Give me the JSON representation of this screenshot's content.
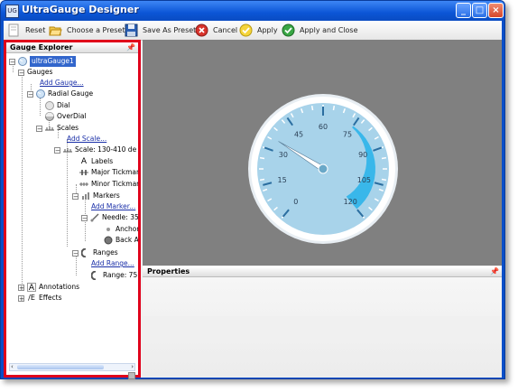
{
  "window": {
    "title": "UltraGauge Designer"
  },
  "title_buttons": {
    "minimize": "_",
    "maximize": "□",
    "close": "×"
  },
  "toolbar": {
    "reset": "Reset",
    "choose_preset": "Choose a Preset",
    "save_preset": "Save As Preset",
    "cancel": "Cancel",
    "apply": "Apply",
    "apply_close": "Apply and Close"
  },
  "explorer": {
    "title": "Gauge Explorer",
    "pin": "📌",
    "tree": {
      "root": "ultraGauge1",
      "gauges": "Gauges",
      "add_gauge": "Add Gauge...",
      "radial_gauge": "Radial Gauge",
      "dial": "Dial",
      "overdial": "OverDial",
      "scales": "Scales",
      "add_scale": "Add Scale...",
      "scale": "Scale: 130-410 de",
      "labels": "Labels",
      "major_tickmarks": "Major Tickmar",
      "minor_tickmarks": "Minor Tickmar",
      "markers": "Markers",
      "add_marker": "Add Marker...",
      "needle": "Needle: 35",
      "anchor": "Anchor",
      "back_anchor": "Back A",
      "ranges": "Ranges",
      "add_range": "Add Range...",
      "range": "Range: 75",
      "annotations": "Annotations",
      "effects": "Effects"
    }
  },
  "properties": {
    "title": "Properties",
    "pin": "📌"
  },
  "gauge": {
    "scale_labels": [
      "0",
      "15",
      "30",
      "45",
      "60",
      "75",
      "90",
      "105",
      "120"
    ],
    "needle_value": 35,
    "range_start": 75,
    "range_end": 120,
    "colors": {
      "face": "#a8d3ea",
      "rim": "#ffffff",
      "range": "#39b7ea",
      "tick": "#2b6ea0",
      "needle": "#ffffff"
    }
  }
}
